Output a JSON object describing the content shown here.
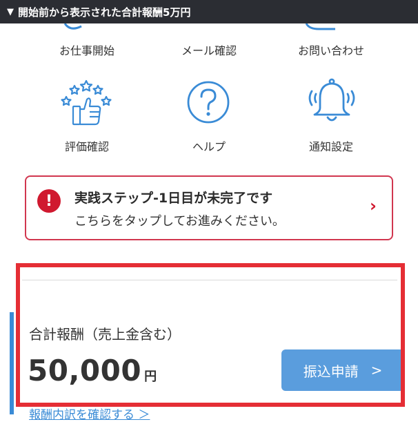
{
  "banner": {
    "toggle_icon": "▼",
    "text": "開始前から表示された合計報酬5万円"
  },
  "menu": {
    "row1": [
      {
        "label": "お仕事開始",
        "icon": "work-icon"
      },
      {
        "label": "メール確認",
        "icon": "mail-icon"
      },
      {
        "label": "お問い合わせ",
        "icon": "chat-icon"
      }
    ],
    "row2": [
      {
        "label": "評価確認",
        "icon": "rating-thumbs-stars-icon"
      },
      {
        "label": "ヘルプ",
        "icon": "help-question-icon",
        "glyph": "?"
      },
      {
        "label": "通知設定",
        "icon": "bell-icon"
      }
    ]
  },
  "alert": {
    "badge": "!",
    "title": "実践ステップ-1日目が未完了です",
    "subtitle": "こちらをタップしてお進みください。",
    "chevron": "›"
  },
  "reward": {
    "label": "合計報酬（売上金含む）",
    "amount": "50,000",
    "unit": "円",
    "button_label": "振込申請",
    "button_chevron": ">",
    "detail_link": "報酬内訳を確認する ＞"
  },
  "colors": {
    "accent_blue": "#3a8bd6",
    "alert_red": "#d0192f",
    "highlight_red": "#e52e35",
    "banner_bg": "#2b2d33"
  }
}
